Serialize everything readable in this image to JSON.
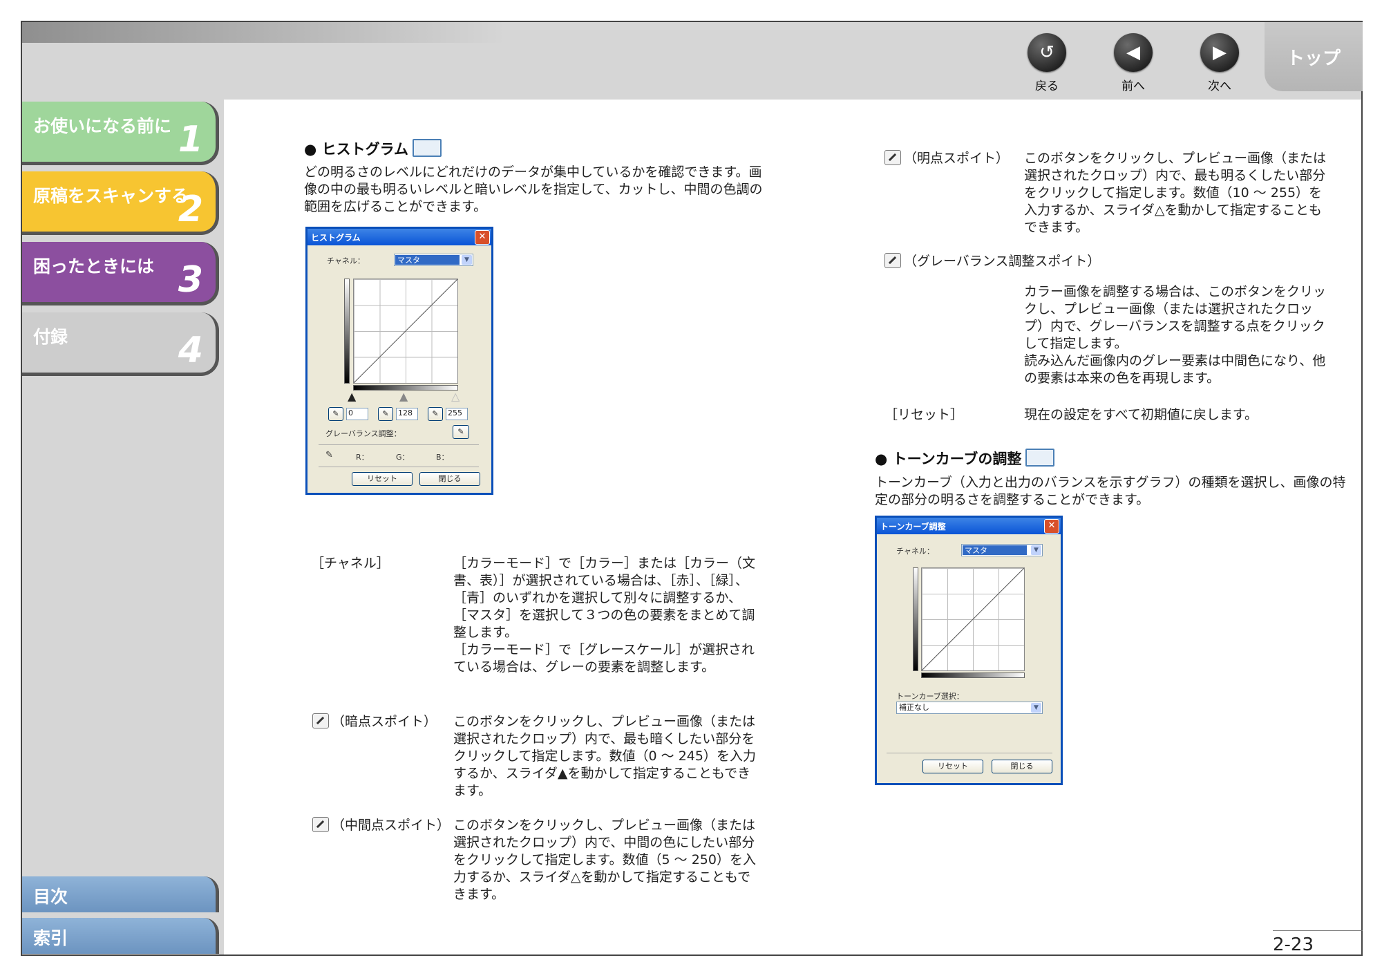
{
  "nav": {
    "back_label": "戻る",
    "prev_label": "前へ",
    "next_label": "次へ",
    "top_label": "トップ"
  },
  "chapters": [
    {
      "title": "お使いになる前に",
      "number": "1",
      "color": "#9fd69b"
    },
    {
      "title": "原稿をスキャンする",
      "number": "2",
      "color": "#f7c531"
    },
    {
      "title": "困ったときには",
      "number": "3",
      "color": "#8c4f9f"
    },
    {
      "title": "付録",
      "number": "4",
      "color": "#cdcdcd"
    }
  ],
  "sidebar": {
    "toc_label": "目次",
    "index_label": "索引"
  },
  "histogram": {
    "title": "● ヒストグラム",
    "intro": "どの明るさのレベルにどれだけのデータが集中しているかを確認できます。画像の中の最も明るいレベルと暗いレベルを指定して、カットし、中間の色調の範囲を広げることができます。",
    "dialog": {
      "caption": "ヒストグラム",
      "channel_label": "チャネル：",
      "channel_value": "マスタ",
      "dark_value": "0",
      "mid_value": "128",
      "light_value": "255",
      "gray_balance_label": "グレーバランス調整：",
      "r_label": "R：",
      "g_label": "G：",
      "b_label": "B：",
      "reset_button": "リセット",
      "close_button": "閉じる"
    }
  },
  "definitions_left": [
    {
      "term": "［チャネル］",
      "icon": false,
      "text": "［カラーモード］で［カラー］または［カラー（文書、表）］が選択されている場合は、［赤］、［緑］、［青］のいずれかを選択して別々に調整するか、［マスタ］を選択して３つの色の要素をまとめて調整します。",
      "text2": "［カラーモード］で［グレースケール］が選択されている場合は、グレーの要素を調整します。"
    },
    {
      "term": "（暗点スポイト）",
      "icon": true,
      "text": "このボタンをクリックし、プレビュー画像（または選択されたクロップ）内で、最も暗くしたい部分をクリックして指定します。数値（0 ～ 245）を入力するか、スライダ▲を動かして指定することもできます。"
    },
    {
      "term": "（中間点スポイト）",
      "icon": true,
      "text": "このボタンをクリックし、プレビュー画像（または選択されたクロップ）内で、中間の色にしたい部分をクリックして指定します。数値（5 ～ 250）を入力するか、スライダ△を動かして指定することもできます。"
    }
  ],
  "definitions_right": [
    {
      "term": "（明点スポイト）",
      "icon": true,
      "text": "このボタンをクリックし、プレビュー画像（または選択されたクロップ）内で、最も明るくしたい部分をクリックして指定します。数値（10 ～ 255）を入力するか、スライダ△を動かして指定することもできます。"
    },
    {
      "term": "（グレーバランス調整スポイト）",
      "icon": true,
      "text": "カラー画像を調整する場合は、このボタンをクリックし、プレビュー画像（または選択されたクロップ）内で、グレーバランスを調整する点をクリックして指定します。",
      "text2": "読み込んだ画像内のグレー要素は中間色になり、他の要素は本来の色を再現します。"
    },
    {
      "term": "［リセット］",
      "icon": false,
      "text": "現在の設定をすべて初期値に戻します。"
    }
  ],
  "tonecurve": {
    "title": "● トーンカーブの調整",
    "intro": "トーンカーブ（入力と出力のバランスを示すグラフ）の種類を選択し、画像の特定の部分の明るさを調整することができます。",
    "dialog": {
      "caption": "トーンカーブ調整",
      "channel_label": "チャネル：",
      "channel_value": "マスタ",
      "curve_select_label": "トーンカーブ選択：",
      "curve_select_value": "補正なし",
      "reset_button": "リセット",
      "close_button": "閉じる"
    }
  },
  "page_number": "2-23"
}
